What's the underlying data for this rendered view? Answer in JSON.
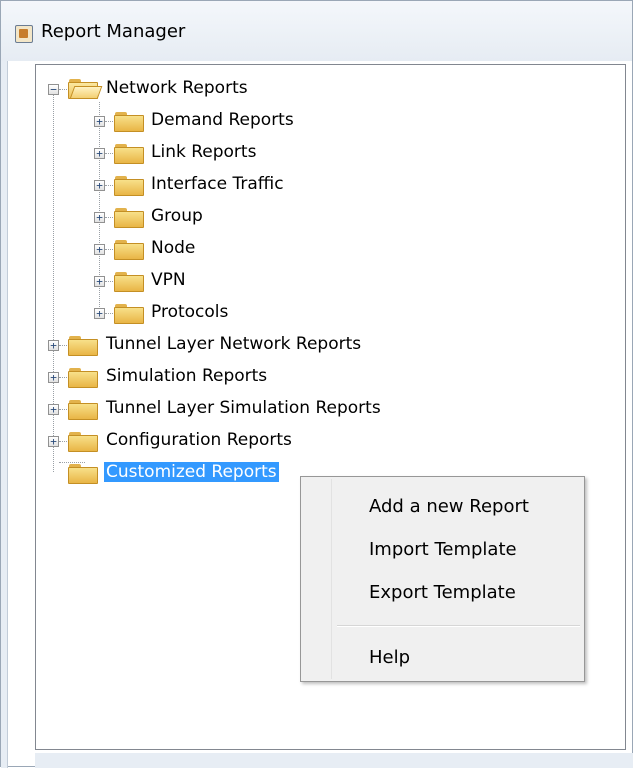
{
  "window": {
    "title": "Report Manager"
  },
  "tree": {
    "root": {
      "label": "Network Reports",
      "children": [
        "Demand Reports",
        "Link Reports",
        "Interface Traffic",
        "Group",
        "Node",
        "VPN",
        "Protocols"
      ]
    },
    "top_level": [
      "Tunnel Layer Network Reports",
      "Simulation Reports",
      "Tunnel Layer Simulation Reports",
      "Configuration Reports",
      "Customized Reports"
    ]
  },
  "context_menu": {
    "items": [
      "Add a new Report",
      "Import Template",
      "Export Template",
      "Help"
    ]
  },
  "colors": {
    "selection": "#3399ff",
    "folder": "#f0c75a"
  },
  "icons": {
    "app": "report-manager-icon",
    "folder": "folder-icon",
    "expander": "plus-box-icon",
    "collapser": "minus-box-icon"
  }
}
